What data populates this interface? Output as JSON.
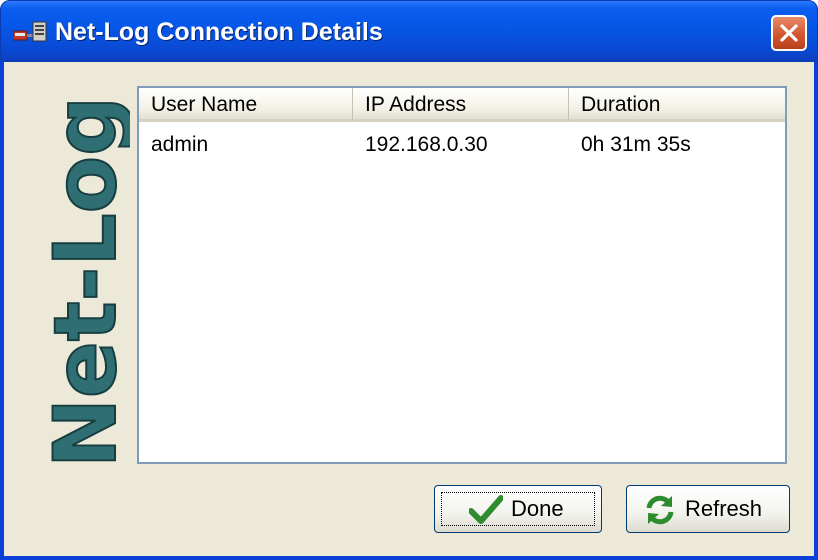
{
  "window": {
    "title": "Net-Log Connection Details",
    "icon": "network-computer-icon",
    "close_icon": "close-icon"
  },
  "brand": {
    "logo_text": "Net-Log",
    "color": "#2f6e73"
  },
  "table": {
    "columns": [
      "User Name",
      "IP Address",
      "Duration"
    ],
    "rows": [
      {
        "user_name": "admin",
        "ip_address": "192.168.0.30",
        "duration": "0h 31m 35s"
      }
    ]
  },
  "buttons": {
    "done_label": "Done",
    "done_icon": "checkmark-icon",
    "refresh_label": "Refresh",
    "refresh_icon": "refresh-icon"
  },
  "colors": {
    "titlebar": "#0656e6",
    "close_button": "#d1532c",
    "dialog_background": "#ece9d8"
  }
}
